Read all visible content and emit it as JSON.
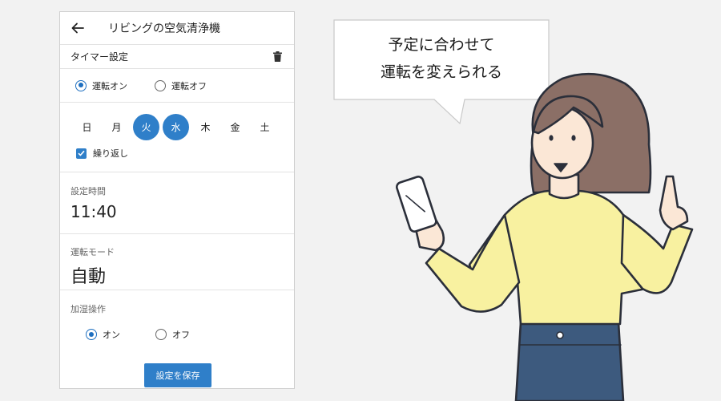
{
  "app": {
    "title": "リビングの空気清浄機"
  },
  "timer": {
    "header_label": "タイマー設定",
    "run_on_label": "運転オン",
    "run_off_label": "運転オフ",
    "run_selected": "on",
    "days": [
      {
        "label": "日",
        "selected": false
      },
      {
        "label": "月",
        "selected": false
      },
      {
        "label": "火",
        "selected": true
      },
      {
        "label": "水",
        "selected": true
      },
      {
        "label": "木",
        "selected": false
      },
      {
        "label": "金",
        "selected": false
      },
      {
        "label": "土",
        "selected": false
      }
    ],
    "repeat_label": "繰り返し",
    "repeat_checked": true,
    "time_label": "設定時間",
    "time_value": "11:40",
    "mode_label": "運転モード",
    "mode_value": "自動",
    "humid_label": "加湿操作",
    "humid_on_label": "オン",
    "humid_off_label": "オフ",
    "humid_selected": "on",
    "save_label": "設定を保存"
  },
  "bubble": {
    "line1": "予定に合わせて",
    "line2": "運転を変えられる"
  },
  "colors": {
    "accent": "#2f7fc9",
    "shirt": "#f8f1a0",
    "hair": "#8b6f66",
    "jeans": "#3d5a7e",
    "outline": "#2b2f3a"
  }
}
